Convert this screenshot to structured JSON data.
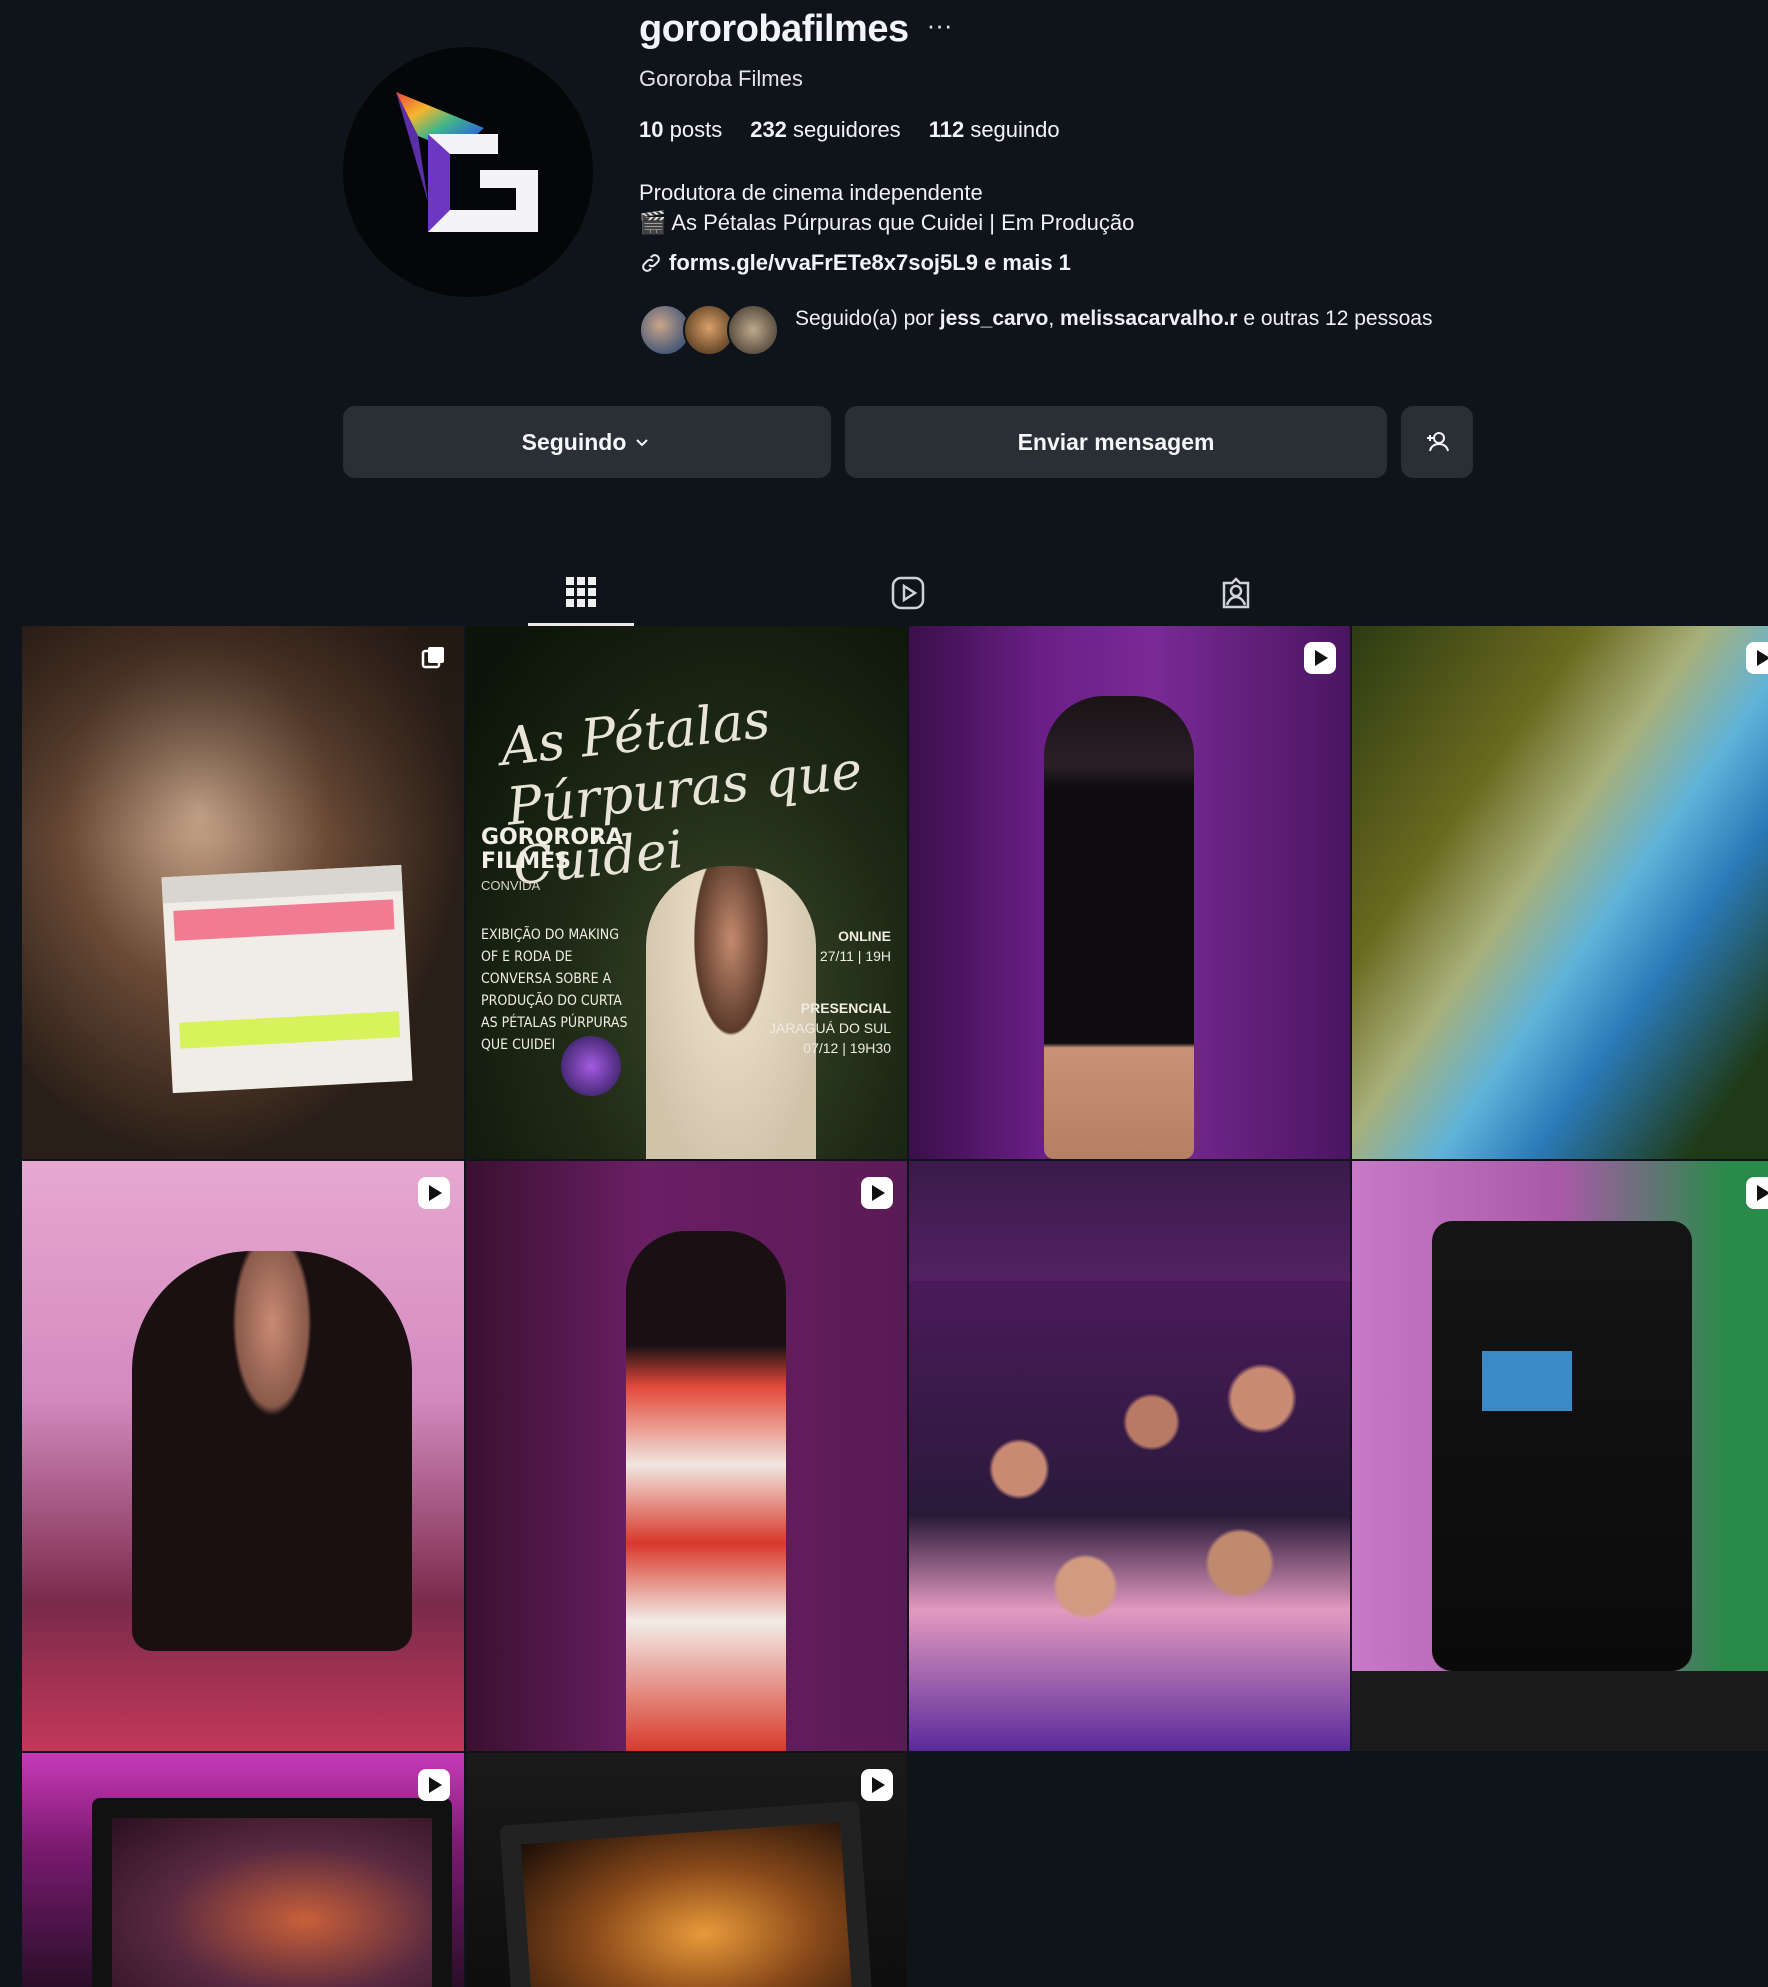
{
  "profile": {
    "username": "gororobafilmes",
    "more_glyph": "···",
    "full_name": "Gororoba Filmes",
    "stats": {
      "posts": "10",
      "posts_label": "posts",
      "followers": "232",
      "followers_label": "seguidores",
      "following": "112",
      "following_label": "seguindo"
    },
    "bio_line1": "Produtora de cinema independente",
    "bio_line2_emoji": "🎬",
    "bio_line2": "As Pétalas Púrpuras que Cuidei | Em Produção",
    "link": "forms.gle/vvaFrETe8x7soj5L9 e mais 1",
    "followed_prefix": "Seguido(a) por ",
    "followed_user1": "jess_carvo",
    "followed_sep": ", ",
    "followed_user2": "melissacarvalho.r",
    "followed_suffix": " e outras 12 pessoas"
  },
  "actions": {
    "following_label": "Seguindo",
    "message_label": "Enviar mensagem"
  },
  "tabs": [
    {
      "icon": "grid-icon",
      "active": true
    },
    {
      "icon": "reels-icon",
      "active": false
    },
    {
      "icon": "tagged-icon",
      "active": false
    }
  ],
  "poster": {
    "title": "As Pétalas Púrpuras que Cuidei",
    "brand": "GORORORA FILMES",
    "brand_line1": "GORORORA",
    "brand_line2": "FILMES",
    "sub": "CONVIDA",
    "desc": "EXIBIÇÃO DO MAKING OF E RODA DE CONVERSA SOBRE A PRODUÇÃO DO CURTA AS PÉTALAS PÚRPURAS QUE CUIDEI",
    "online_label": "ONLINE",
    "online_date": "27/11 | 19H",
    "presencial_label": "PRESENCIAL",
    "presencial_place": "JARAGUÁ DO SUL",
    "presencial_date": "07/12 | 19H30"
  },
  "colors": {
    "background": "#0f141b",
    "button": "#2a2f36",
    "text": "#f2f4f7"
  }
}
